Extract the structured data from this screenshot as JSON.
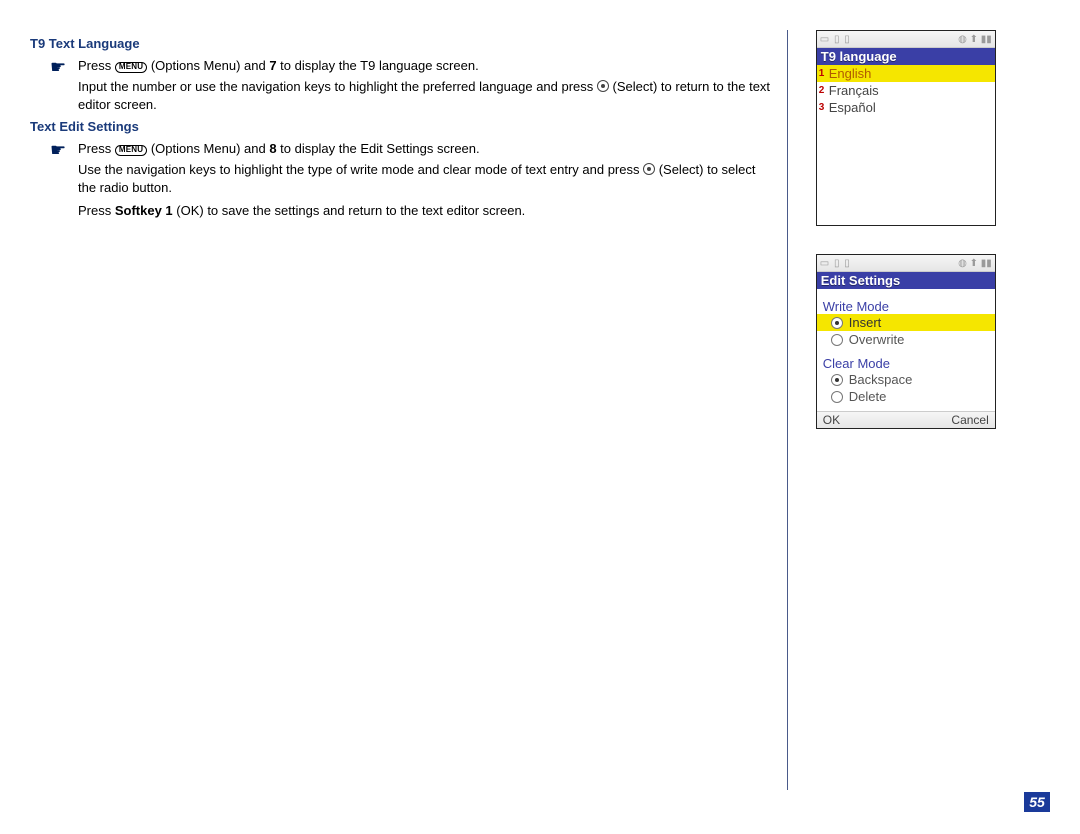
{
  "sections": {
    "t9lang": {
      "heading": "T9 Text Language",
      "menu_label": "MENU",
      "step1_a": "Press ",
      "step1_b": " (Options Menu) and ",
      "step1_num": "7",
      "step1_c": " to display the T9 language screen.",
      "sub1_a": "Input the number or use the navigation keys to highlight the preferred language and press ",
      "sub1_b": " (Select) to return to the text editor screen."
    },
    "editset": {
      "heading": "Text Edit Settings",
      "menu_label": "MENU",
      "step1_a": "Press ",
      "step1_b": " (Options Menu) and ",
      "step1_num": "8",
      "step1_c": " to display the Edit Settings screen.",
      "sub1_a": "Use the navigation keys to highlight the type of write mode and clear mode of text entry and press ",
      "sub1_b": " (Select) to select the radio button.",
      "sub2_a": "Press ",
      "sub2_soft": "Softkey 1",
      "sub2_b": " (OK) to save the settings and return to the text editor screen."
    }
  },
  "phone1": {
    "title": "T9 language",
    "items": [
      {
        "num": "1",
        "label": "English",
        "hl": true
      },
      {
        "num": "2",
        "label": "Français",
        "hl": false
      },
      {
        "num": "3",
        "label": "Español",
        "hl": false
      }
    ]
  },
  "phone2": {
    "title": "Edit Settings",
    "group1": "Write Mode",
    "g1": [
      {
        "label": "Insert",
        "sel": true,
        "hl": true
      },
      {
        "label": "Overwrite",
        "sel": false,
        "hl": false
      }
    ],
    "group2": "Clear Mode",
    "g2": [
      {
        "label": "Backspace",
        "sel": true,
        "hl": false
      },
      {
        "label": "Delete",
        "sel": false,
        "hl": false
      }
    ],
    "soft_left": "OK",
    "soft_right": "Cancel"
  },
  "status": {
    "left": "▭ ▯ ▯",
    "right": "◍ ⬆ ▮▮"
  },
  "page_number": "55"
}
